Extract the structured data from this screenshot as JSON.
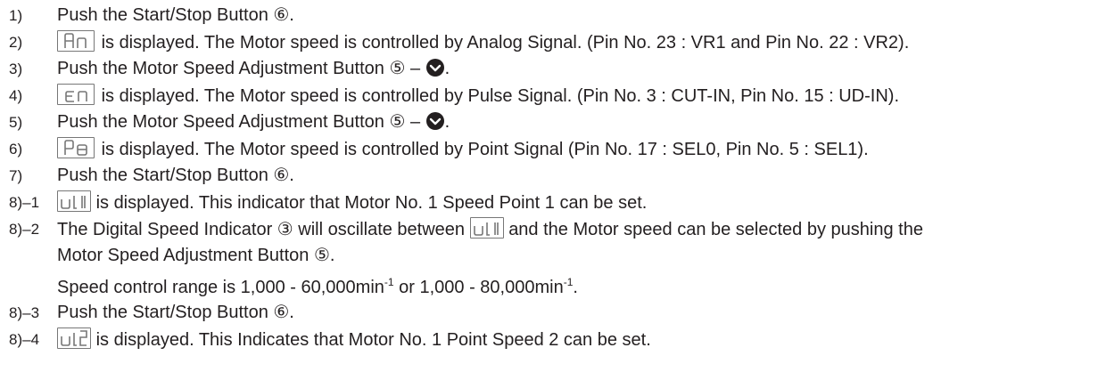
{
  "steps": [
    {
      "num": "1)",
      "text": "Push the Start/Stop Button ⑥."
    },
    {
      "num": "2)",
      "display": "An",
      "text": "is displayed. The Motor speed is controlled by Analog Signal. (Pin No. 23 : VR1 and Pin No. 22 : VR2)."
    },
    {
      "num": "3)",
      "text_before": "Push the Motor Speed Adjustment Button ⑤ – ",
      "text_after": "."
    },
    {
      "num": "4)",
      "display": "cn",
      "text": "is displayed. The Motor speed is controlled by Pulse Signal. (Pin No. 3 : CUT-IN, Pin No. 15 : UD-IN)."
    },
    {
      "num": "5)",
      "text_before": "Push the Motor Speed Adjustment Button ⑤ – ",
      "text_after": "."
    },
    {
      "num": "6)",
      "display": "Po",
      "text": "is displayed. The Motor speed is controlled by Point Signal (Pin No. 17 : SEL0, Pin No. 5 : SEL1)."
    },
    {
      "num": "7)",
      "text": "Push the Start/Stop Button ⑥."
    },
    {
      "num": "8)–1",
      "display": "u11",
      "text": "is displayed. This indicator that Motor No. 1 Speed Point 1 can be set."
    },
    {
      "num": "8)–2",
      "text_before": "The Digital Speed Indicator ③ will oscillate between",
      "display": "u11",
      "text_after": "and the Motor speed can be selected by pushing the"
    },
    {
      "text": "Motor Speed Adjustment Button ⑤."
    },
    {
      "text_before": "Speed control range is 1,000 - 60,000min",
      "sup1": "-1",
      "text_mid": " or 1,000 - 80,000min",
      "sup2": "-1",
      "text_after": "."
    },
    {
      "num": "8)–3",
      "text": "Push the Start/Stop Button ⑥."
    },
    {
      "num": "8)–4",
      "display": "u12",
      "text": "is displayed. This Indicates that Motor No. 1 Point Speed 2 can be set."
    }
  ]
}
